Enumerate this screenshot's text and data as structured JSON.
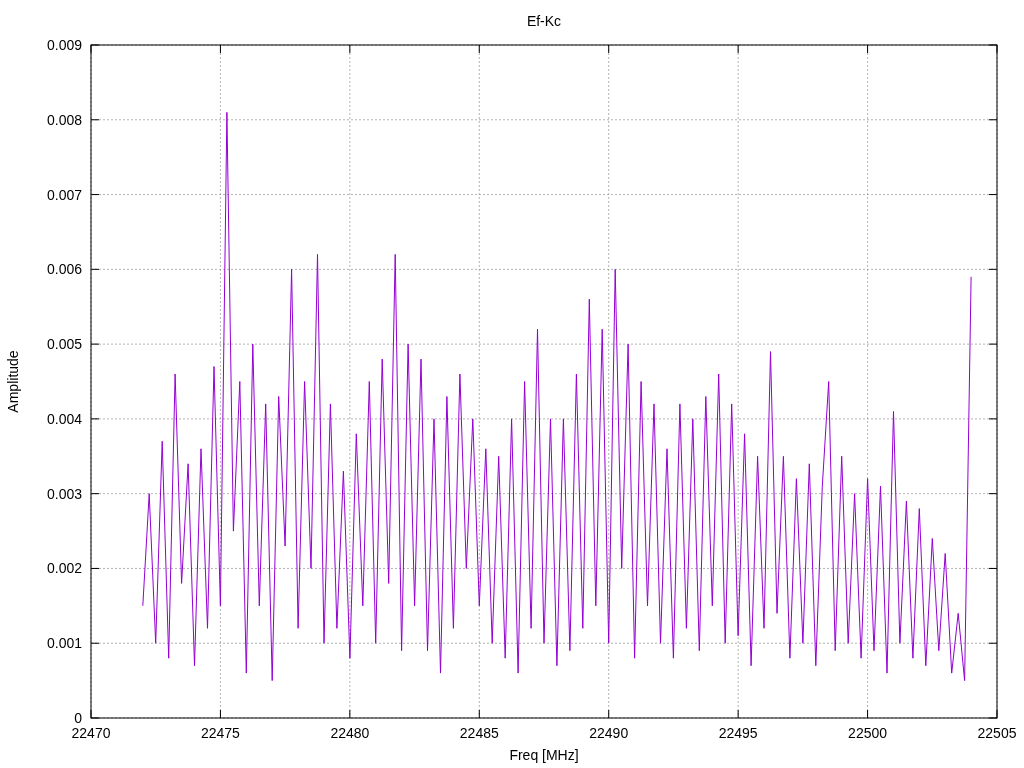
{
  "chart_data": {
    "type": "line",
    "title": "Ef-Kc",
    "xlabel": "Freq [MHz]",
    "ylabel": "Amplitude",
    "grid": true,
    "xlim": [
      22470,
      22505
    ],
    "ylim": [
      0,
      0.009
    ],
    "xticks": [
      22470,
      22475,
      22480,
      22485,
      22490,
      22495,
      22500,
      22505
    ],
    "yticks": [
      {
        "value": 0,
        "label": "0"
      },
      {
        "value": 0.001,
        "label": "0.001"
      },
      {
        "value": 0.002,
        "label": "0.002"
      },
      {
        "value": 0.003,
        "label": "0.003"
      },
      {
        "value": 0.004,
        "label": "0.004"
      },
      {
        "value": 0.005,
        "label": "0.005"
      },
      {
        "value": 0.006,
        "label": "0.006"
      },
      {
        "value": 0.007,
        "label": "0.007"
      },
      {
        "value": 0.008,
        "label": "0.008"
      },
      {
        "value": 0.009,
        "label": "0.009"
      }
    ],
    "x": [
      22472,
      22472.25,
      22472.5,
      22472.75,
      22473,
      22473.25,
      22473.5,
      22473.75,
      22474,
      22474.25,
      22474.5,
      22474.75,
      22475,
      22475.25,
      22475.5,
      22475.75,
      22476,
      22476.25,
      22476.5,
      22476.75,
      22477,
      22477.25,
      22477.5,
      22477.75,
      22478,
      22478.25,
      22478.5,
      22478.75,
      22479,
      22479.25,
      22479.5,
      22479.75,
      22480,
      22480.25,
      22480.5,
      22480.75,
      22481,
      22481.25,
      22481.5,
      22481.75,
      22482,
      22482.25,
      22482.5,
      22482.75,
      22483,
      22483.25,
      22483.5,
      22483.75,
      22484,
      22484.25,
      22484.5,
      22484.75,
      22485,
      22485.25,
      22485.5,
      22485.75,
      22486,
      22486.25,
      22486.5,
      22486.75,
      22487,
      22487.25,
      22487.5,
      22487.75,
      22488,
      22488.25,
      22488.5,
      22488.75,
      22489,
      22489.25,
      22489.5,
      22489.75,
      22490,
      22490.25,
      22490.5,
      22490.75,
      22491,
      22491.25,
      22491.5,
      22491.75,
      22492,
      22492.25,
      22492.5,
      22492.75,
      22493,
      22493.25,
      22493.5,
      22493.75,
      22494,
      22494.25,
      22494.5,
      22494.75,
      22495,
      22495.25,
      22495.5,
      22495.75,
      22496,
      22496.25,
      22496.5,
      22496.75,
      22497,
      22497.25,
      22497.5,
      22497.75,
      22498,
      22498.25,
      22498.5,
      22498.75,
      22499,
      22499.25,
      22499.5,
      22499.75,
      22500,
      22500.25,
      22500.5,
      22500.75,
      22501,
      22501.25,
      22501.5,
      22501.75,
      22502,
      22502.25,
      22502.5,
      22502.75,
      22503,
      22503.25,
      22503.5,
      22503.75,
      22504
    ],
    "series": [
      {
        "color": "#9400d3",
        "values": [
          0.0015,
          0.003,
          0.001,
          0.0037,
          0.0008,
          0.0046,
          0.0018,
          0.0034,
          0.0007,
          0.0036,
          0.0012,
          0.0047,
          0.0015,
          0.0081,
          0.0025,
          0.0045,
          0.0006,
          0.005,
          0.0015,
          0.0042,
          0.0005,
          0.0043,
          0.0023,
          0.006,
          0.0012,
          0.0045,
          0.002,
          0.0062,
          0.001,
          0.0042,
          0.0012,
          0.0033,
          0.0008,
          0.0038,
          0.0015,
          0.0045,
          0.001,
          0.0048,
          0.0018,
          0.0062,
          0.0009,
          0.005,
          0.0015,
          0.0048,
          0.0009,
          0.004,
          0.0006,
          0.0043,
          0.0012,
          0.0046,
          0.002,
          0.004,
          0.0015,
          0.0036,
          0.001,
          0.0035,
          0.0008,
          0.004,
          0.0006,
          0.0045,
          0.0012,
          0.0052,
          0.001,
          0.004,
          0.0007,
          0.004,
          0.0009,
          0.0046,
          0.0012,
          0.0056,
          0.0015,
          0.0052,
          0.001,
          0.006,
          0.002,
          0.005,
          0.0008,
          0.0045,
          0.0015,
          0.0042,
          0.001,
          0.0036,
          0.0008,
          0.0042,
          0.0012,
          0.004,
          0.0009,
          0.0043,
          0.0015,
          0.0046,
          0.001,
          0.0042,
          0.0011,
          0.0038,
          0.0007,
          0.0035,
          0.0012,
          0.0049,
          0.0014,
          0.0035,
          0.0008,
          0.0032,
          0.001,
          0.0034,
          0.0007,
          0.0031,
          0.0045,
          0.0009,
          0.0035,
          0.001,
          0.003,
          0.0008,
          0.0032,
          0.0009,
          0.0031,
          0.0006,
          0.0041,
          0.001,
          0.0029,
          0.0008,
          0.0028,
          0.0007,
          0.0024,
          0.0009,
          0.0022,
          0.0006,
          0.0014,
          0.0005,
          0.0059
        ]
      }
    ]
  }
}
